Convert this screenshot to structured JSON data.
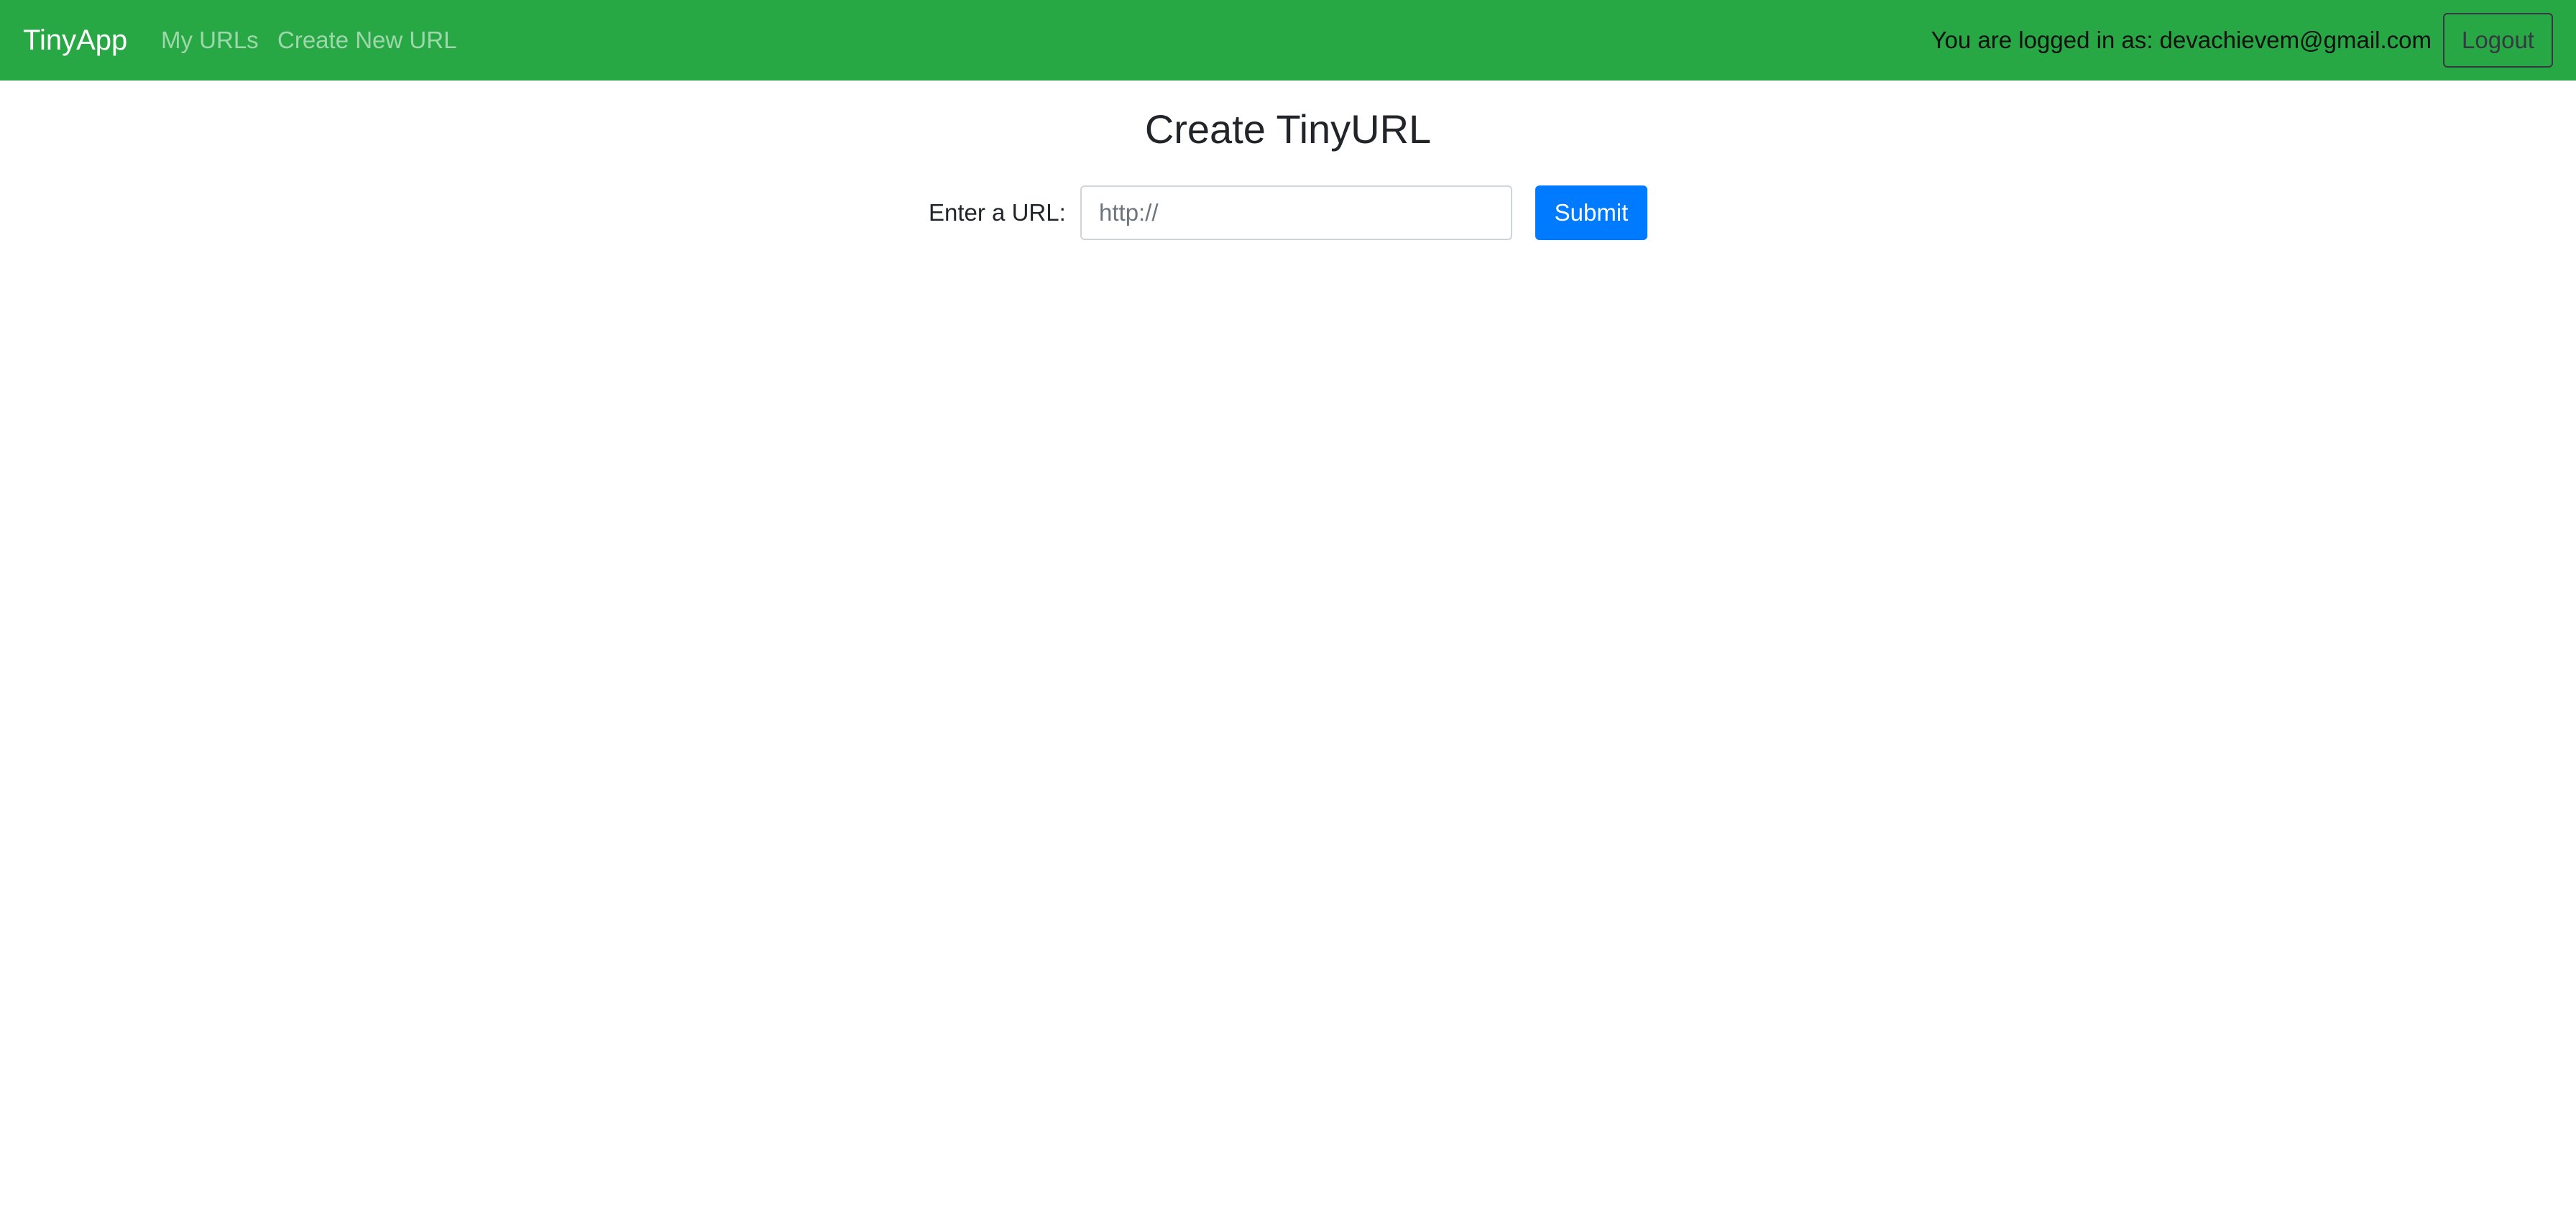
{
  "navbar": {
    "brand": "TinyApp",
    "links": [
      {
        "label": "My URLs"
      },
      {
        "label": "Create New URL"
      }
    ],
    "login_text": "You are logged in as: devachievem@gmail.com",
    "logout_label": "Logout",
    "background_color": "#28a745"
  },
  "main": {
    "title": "Create TinyURL",
    "form": {
      "label": "Enter a URL:",
      "input_placeholder": "http://",
      "input_value": "",
      "submit_label": "Submit",
      "submit_color": "#007bff"
    }
  }
}
